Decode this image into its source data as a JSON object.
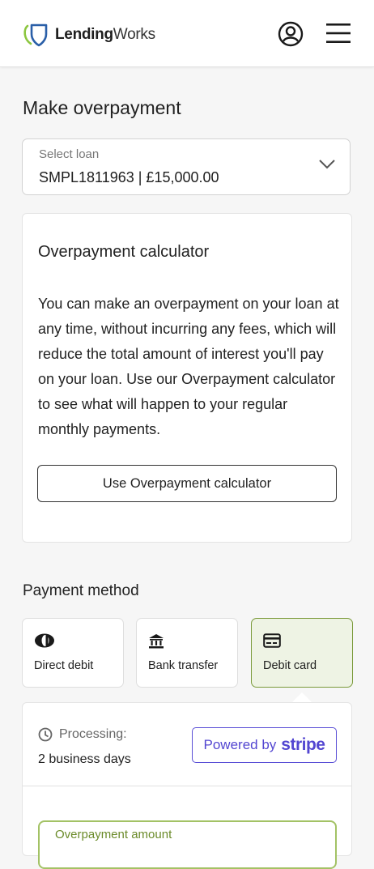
{
  "header": {
    "logo_bold": "Lending",
    "logo_light": "Works",
    "user_icon": "user-circle-icon",
    "menu_icon": "hamburger-menu-icon"
  },
  "page": {
    "title": "Make overpayment"
  },
  "loan_select": {
    "label": "Select loan",
    "value": "SMPL1811963 | £15,000.00",
    "icon": "chevron-down-icon"
  },
  "calculator_card": {
    "title": "Overpayment calculator",
    "body": "You can make an overpayment on your loan at any time, without incurring any fees, which will reduce the total amount of interest you'll pay on your loan. Use our Overpayment calculator to see what will happen to your regular monthly payments.",
    "button_label": "Use Overpayment calculator"
  },
  "payment_method": {
    "title": "Payment method",
    "options": [
      {
        "label": "Direct debit",
        "icon": "direct-debit-icon",
        "selected": false
      },
      {
        "label": "Bank transfer",
        "icon": "bank-icon",
        "selected": false
      },
      {
        "label": "Debit card",
        "icon": "card-icon",
        "selected": true
      }
    ]
  },
  "details": {
    "processing_label": "Processing:",
    "processing_value": "2 business days",
    "powered_by": "Powered by",
    "stripe": "stripe",
    "amount_label": "Overpayment amount"
  },
  "colors": {
    "accent_green": "#7a9a3a",
    "selected_bg": "#eef3e4",
    "stripe_purple": "#5346d1",
    "logo_green": "#8cc63f",
    "logo_blue": "#2a5fa8"
  }
}
